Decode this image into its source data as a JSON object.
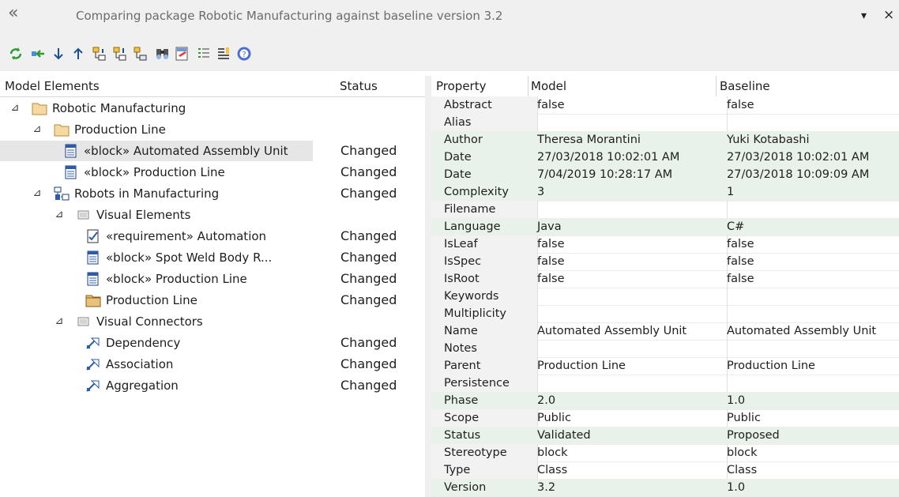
{
  "window": {
    "title": "Comparing package Robotic Manufacturing against baseline version 3.2",
    "collapse_glyph": "«",
    "menu_glyph": "▾",
    "close_glyph": "×"
  },
  "toolbar": {
    "buttons": [
      "refresh-icon",
      "restore-icon",
      "arrow-down-icon",
      "arrow-up-icon",
      "expand-tree-icon",
      "collapse-tree-icon",
      "select-tree-icon",
      "find-icon",
      "xml-export-icon",
      "filter-icon",
      "options-icon",
      "help-icon"
    ]
  },
  "tree": {
    "headers": {
      "elements": "Model Elements",
      "status": "Status"
    },
    "rows": [
      {
        "label": "Robotic Manufacturing",
        "status": "",
        "icon": "folder-icon",
        "expander": "⊿"
      },
      {
        "label": "Production Line",
        "status": "",
        "icon": "folder-icon",
        "expander": "⊿"
      },
      {
        "label": "«block» Automated Assembly Unit",
        "status": "Changed",
        "icon": "block-icon",
        "expander": ""
      },
      {
        "label": "«block» Production Line",
        "status": "Changed",
        "icon": "block-icon",
        "expander": ""
      },
      {
        "label": "Robots in Manufacturing",
        "status": "Changed",
        "icon": "diagram-icon",
        "expander": "⊿"
      },
      {
        "label": "Visual Elements",
        "status": "",
        "icon": "group-icon",
        "expander": "⊿"
      },
      {
        "label": "«requirement» Automation",
        "status": "Changed",
        "icon": "requirement-icon",
        "expander": ""
      },
      {
        "label": "«block» Spot Weld Body R...",
        "status": "Changed",
        "icon": "block-icon",
        "expander": ""
      },
      {
        "label": "«block» Production Line",
        "status": "Changed",
        "icon": "block-icon",
        "expander": ""
      },
      {
        "label": "Production Line",
        "status": "Changed",
        "icon": "package-icon",
        "expander": ""
      },
      {
        "label": "Visual Connectors",
        "status": "",
        "icon": "group-icon",
        "expander": "⊿"
      },
      {
        "label": "Dependency",
        "status": "Changed",
        "icon": "connector-icon",
        "expander": ""
      },
      {
        "label": "Association",
        "status": "Changed",
        "icon": "connector-icon",
        "expander": ""
      },
      {
        "label": "Aggregation",
        "status": "Changed",
        "icon": "connector-icon",
        "expander": ""
      }
    ]
  },
  "properties": {
    "headers": {
      "property": "Property",
      "model": "Model",
      "baseline": "Baseline"
    },
    "rows": [
      {
        "property": "Abstract",
        "model": "false",
        "baseline": "false",
        "changed": false
      },
      {
        "property": "Alias",
        "model": "",
        "baseline": "",
        "changed": false
      },
      {
        "property": "Author",
        "model": "Theresa Morantini",
        "baseline": "Yuki Kotabashi",
        "changed": true
      },
      {
        "property": "Date",
        "model": "27/03/2018 10:02:01 AM",
        "baseline": "27/03/2018 10:02:01 AM",
        "changed": true
      },
      {
        "property": "Date",
        "model": "7/04/2019 10:28:17 AM",
        "baseline": "27/03/2018 10:09:09 AM",
        "changed": true
      },
      {
        "property": "Complexity",
        "model": "3",
        "baseline": "1",
        "changed": true
      },
      {
        "property": "Filename",
        "model": "",
        "baseline": "",
        "changed": false
      },
      {
        "property": "Language",
        "model": "Java",
        "baseline": "C#",
        "changed": true
      },
      {
        "property": "IsLeaf",
        "model": "false",
        "baseline": "false",
        "changed": false
      },
      {
        "property": "IsSpec",
        "model": "false",
        "baseline": "false",
        "changed": false
      },
      {
        "property": "IsRoot",
        "model": "false",
        "baseline": "false",
        "changed": false
      },
      {
        "property": "Keywords",
        "model": "",
        "baseline": "",
        "changed": false
      },
      {
        "property": "Multiplicity",
        "model": "",
        "baseline": "",
        "changed": false
      },
      {
        "property": "Name",
        "model": "Automated Assembly Unit",
        "baseline": "Automated Assembly Unit",
        "changed": false
      },
      {
        "property": "Notes",
        "model": "",
        "baseline": "",
        "changed": false
      },
      {
        "property": "Parent",
        "model": "Production Line",
        "baseline": "Production Line",
        "changed": false
      },
      {
        "property": "Persistence",
        "model": "",
        "baseline": "",
        "changed": false
      },
      {
        "property": "Phase",
        "model": "2.0",
        "baseline": "1.0",
        "changed": true
      },
      {
        "property": "Scope",
        "model": "Public",
        "baseline": "Public",
        "changed": false
      },
      {
        "property": "Status",
        "model": "Validated",
        "baseline": "Proposed",
        "changed": true
      },
      {
        "property": "Stereotype",
        "model": "block",
        "baseline": "block",
        "changed": false
      },
      {
        "property": "Type",
        "model": "Class",
        "baseline": "Class",
        "changed": false
      },
      {
        "property": "Version",
        "model": "3.2",
        "baseline": "1.0",
        "changed": true
      }
    ]
  },
  "colors": {
    "changed_row": "#e9f2ea",
    "header_bg": "#f0f0f0",
    "selection": "#e6e6e6"
  }
}
